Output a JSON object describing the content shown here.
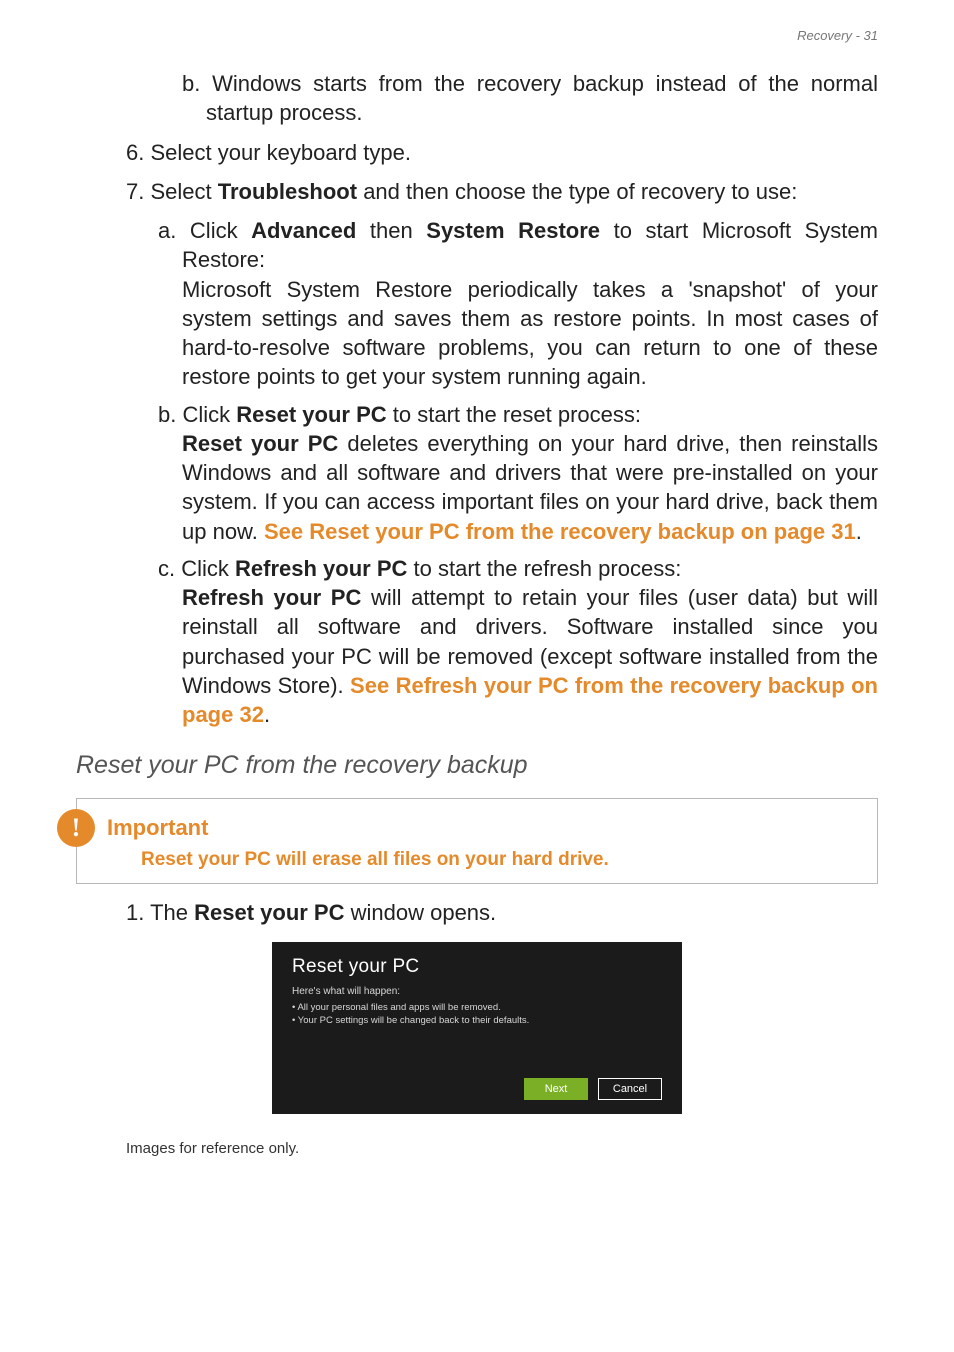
{
  "header": {
    "right": "Recovery - 31"
  },
  "list": {
    "item_b_top": {
      "prefix": "b.",
      "text": "Windows starts from the recovery backup instead of the normal startup process."
    },
    "step6": {
      "prefix": "6.",
      "text": "Select your keyboard type."
    },
    "step7": {
      "prefix": "7.",
      "lead": "Select ",
      "bold": "Troubleshoot",
      "tail": " and then choose the type of recovery to use:"
    },
    "a": {
      "prefix": "a.",
      "l1_pre": "Click ",
      "l1_b1": "Advanced",
      "l1_mid": " then ",
      "l1_b2": "System Restore",
      "l1_post": " to start Microsoft System Restore:",
      "para": "Microsoft System Restore periodically takes a 'snapshot' of your system settings and saves them as restore points. In most cases of hard-to-resolve software problems, you can return to one of these restore points to get your system running again."
    },
    "b": {
      "prefix": "b.",
      "l1_pre": "Click ",
      "l1_b1": "Reset your PC",
      "l1_post": " to start the reset process:",
      "p_b": "Reset your PC",
      "p_text": " deletes everything on your hard drive, then reinstalls Windows and all software and drivers that were pre-installed on your system. If you can access important files on your hard drive, back them up now. ",
      "link": "See Reset your PC from the recovery backup on page 31",
      "dot": "."
    },
    "c": {
      "prefix": "c.",
      "l1_pre": " Click ",
      "l1_b1": "Refresh your PC",
      "l1_post": " to start the refresh process:",
      "p_b": "Refresh your PC",
      "p_text": " will attempt to retain your files (user data) but will reinstall all software and drivers. Software installed since you purchased your PC will be removed (except software installed from the Windows Store). ",
      "link": "See Refresh your PC from the recovery backup on page 32",
      "dot": "."
    }
  },
  "section_heading": "Reset your PC from the recovery backup",
  "important": {
    "title": "Important",
    "text": "Reset your PC will erase all files on your hard drive."
  },
  "step1": {
    "prefix": "1.",
    "pre": "The ",
    "bold": "Reset your PC",
    "post": " window opens."
  },
  "dialog": {
    "title": "Reset your PC",
    "sub": "Here's what will happen:",
    "b1": "• All your personal files and apps will be removed.",
    "b2": "• Your PC settings will be changed back to their defaults.",
    "next": "Next",
    "cancel": "Cancel"
  },
  "footnote": "Images for reference only."
}
